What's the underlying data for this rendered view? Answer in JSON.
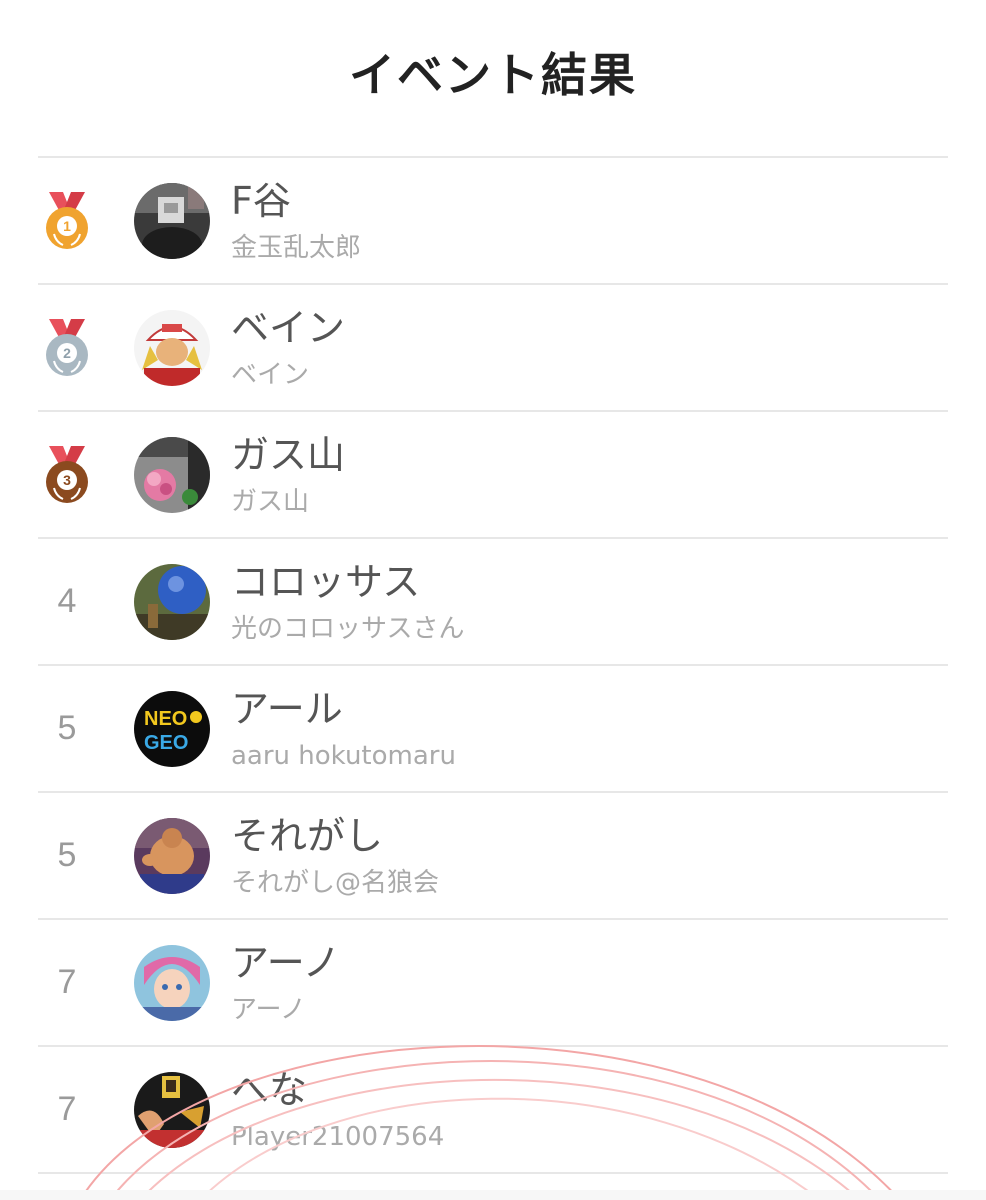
{
  "page_title": "イベント結果",
  "results": [
    {
      "rank": "1",
      "medal": "gold",
      "name": "F谷",
      "sub": "金玉乱太郎",
      "avatar_icon": "dark-figure-avatar"
    },
    {
      "rank": "2",
      "medal": "silver",
      "name": "ベイン",
      "sub": "ベイン",
      "avatar_icon": "capped-fighter-avatar"
    },
    {
      "rank": "3",
      "medal": "bronze",
      "name": "ガス山",
      "sub": "ガス山",
      "avatar_icon": "flower-avatar"
    },
    {
      "rank": "4",
      "medal": null,
      "name": "コロッサス",
      "sub": "光のコロッサスさん",
      "avatar_icon": "blue-orb-avatar"
    },
    {
      "rank": "5",
      "medal": null,
      "name": "アール",
      "sub": "aaru hokutomaru",
      "avatar_icon": "neo-geo-logo-avatar"
    },
    {
      "rank": "5",
      "medal": null,
      "name": "それがし",
      "sub": "それがし@名狼会",
      "avatar_icon": "wrestler-avatar"
    },
    {
      "rank": "7",
      "medal": null,
      "name": "アーノ",
      "sub": "アーノ",
      "avatar_icon": "anime-girl-avatar"
    },
    {
      "rank": "7",
      "medal": null,
      "name": "へな",
      "sub": "Player21007564",
      "avatar_icon": "fighting-game-avatar"
    }
  ],
  "colors": {
    "gold": "#f0a32f",
    "silver": "#a9b8c2",
    "bronze": "#8b4a1f",
    "ribbon": "#e8505b"
  }
}
